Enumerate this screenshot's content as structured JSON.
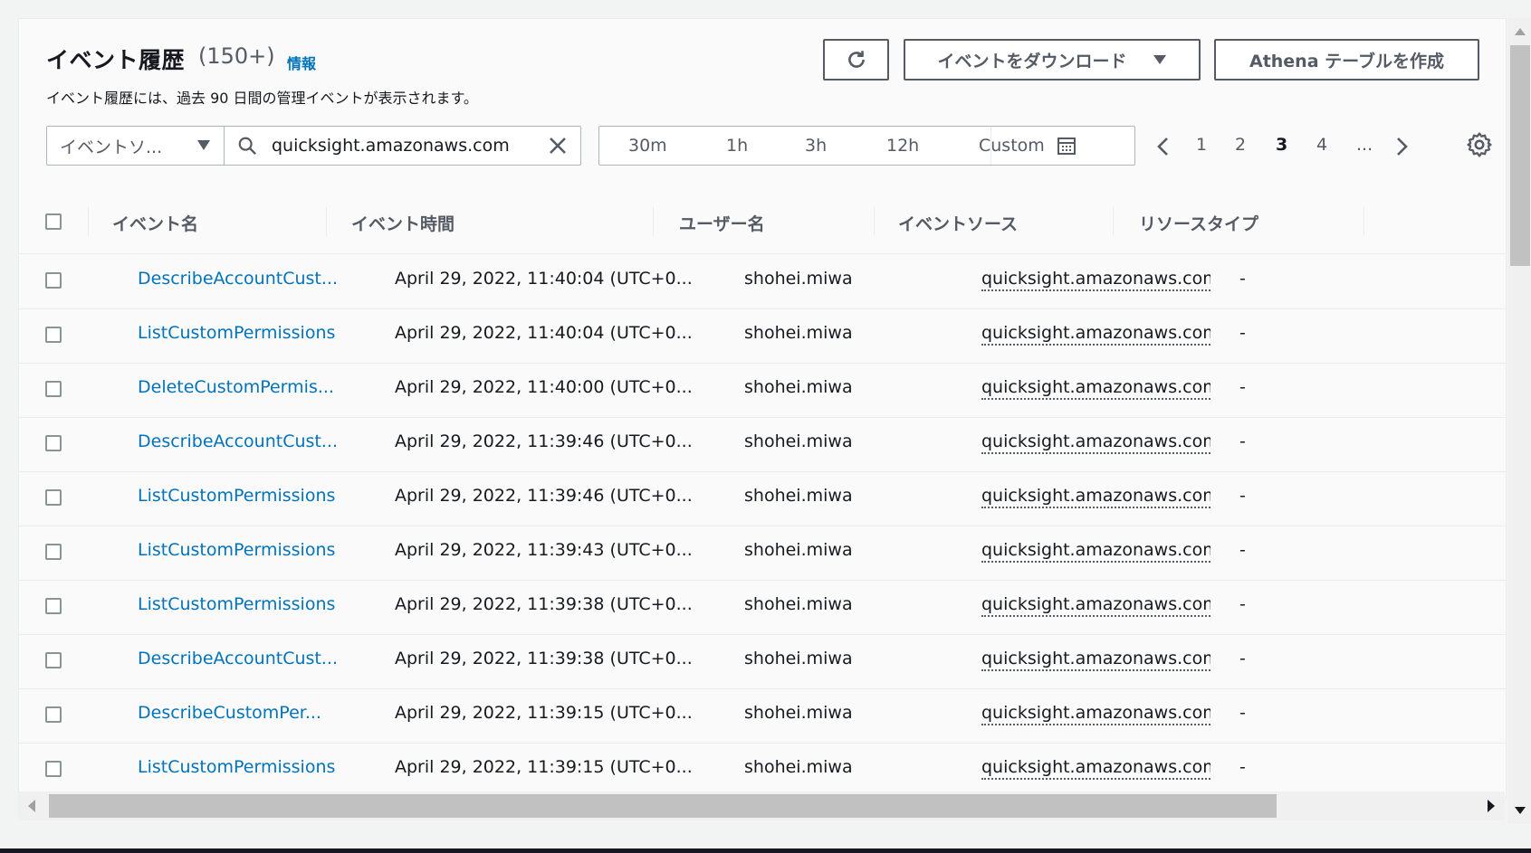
{
  "header": {
    "title": "イベント履歴",
    "count": "(150+)",
    "info_link": "情報",
    "description": "イベント履歴には、過去 90 日間の管理イベントが表示されます。"
  },
  "toolbar": {
    "download_label": "イベントをダウンロード",
    "athena_label": "Athena テーブルを作成"
  },
  "filter": {
    "property_label": "イベントソ...",
    "search_value": "quicksight.amazonaws.com"
  },
  "time_range": {
    "options": [
      "30m",
      "1h",
      "3h",
      "12h"
    ],
    "custom_label": "Custom"
  },
  "pagination": {
    "pages": [
      "1",
      "2",
      "3",
      "4"
    ],
    "ellipsis": "...",
    "current": "3"
  },
  "table": {
    "columns": [
      "イベント名",
      "イベント時間",
      "ユーザー名",
      "イベントソース",
      "リソースタイプ"
    ],
    "rows": [
      {
        "name": "DescribeAccountCust...",
        "time": "April 29, 2022, 11:40:04 (UTC+0...",
        "user": "shohei.miwa",
        "source": "quicksight.amazonaws.com",
        "resource": "-"
      },
      {
        "name": "ListCustomPermissions",
        "time": "April 29, 2022, 11:40:04 (UTC+0...",
        "user": "shohei.miwa",
        "source": "quicksight.amazonaws.com",
        "resource": "-"
      },
      {
        "name": "DeleteCustomPermis...",
        "time": "April 29, 2022, 11:40:00 (UTC+0...",
        "user": "shohei.miwa",
        "source": "quicksight.amazonaws.com",
        "resource": "-"
      },
      {
        "name": "DescribeAccountCust...",
        "time": "April 29, 2022, 11:39:46 (UTC+0...",
        "user": "shohei.miwa",
        "source": "quicksight.amazonaws.com",
        "resource": "-"
      },
      {
        "name": "ListCustomPermissions",
        "time": "April 29, 2022, 11:39:46 (UTC+0...",
        "user": "shohei.miwa",
        "source": "quicksight.amazonaws.com",
        "resource": "-"
      },
      {
        "name": "ListCustomPermissions",
        "time": "April 29, 2022, 11:39:43 (UTC+0...",
        "user": "shohei.miwa",
        "source": "quicksight.amazonaws.com",
        "resource": "-"
      },
      {
        "name": "ListCustomPermissions",
        "time": "April 29, 2022, 11:39:38 (UTC+0...",
        "user": "shohei.miwa",
        "source": "quicksight.amazonaws.com",
        "resource": "-"
      },
      {
        "name": "DescribeAccountCust...",
        "time": "April 29, 2022, 11:39:38 (UTC+0...",
        "user": "shohei.miwa",
        "source": "quicksight.amazonaws.com",
        "resource": "-"
      },
      {
        "name": "DescribeCustomPer...",
        "time": "April 29, 2022, 11:39:15 (UTC+0...",
        "user": "shohei.miwa",
        "source": "quicksight.amazonaws.com",
        "resource": "-"
      },
      {
        "name": "ListCustomPermissions",
        "time": "April 29, 2022, 11:39:15 (UTC+0...",
        "user": "shohei.miwa",
        "source": "quicksight.amazonaws.com",
        "resource": "-"
      }
    ]
  },
  "colors": {
    "link": "#0073bb",
    "text": "#16191f",
    "muted": "#545b64",
    "border": "#aab7b8"
  },
  "icons": [
    "refresh-icon",
    "caret-down-icon",
    "search-icon",
    "close-icon",
    "calendar-icon",
    "chevron-left-icon",
    "chevron-right-icon",
    "gear-icon"
  ]
}
